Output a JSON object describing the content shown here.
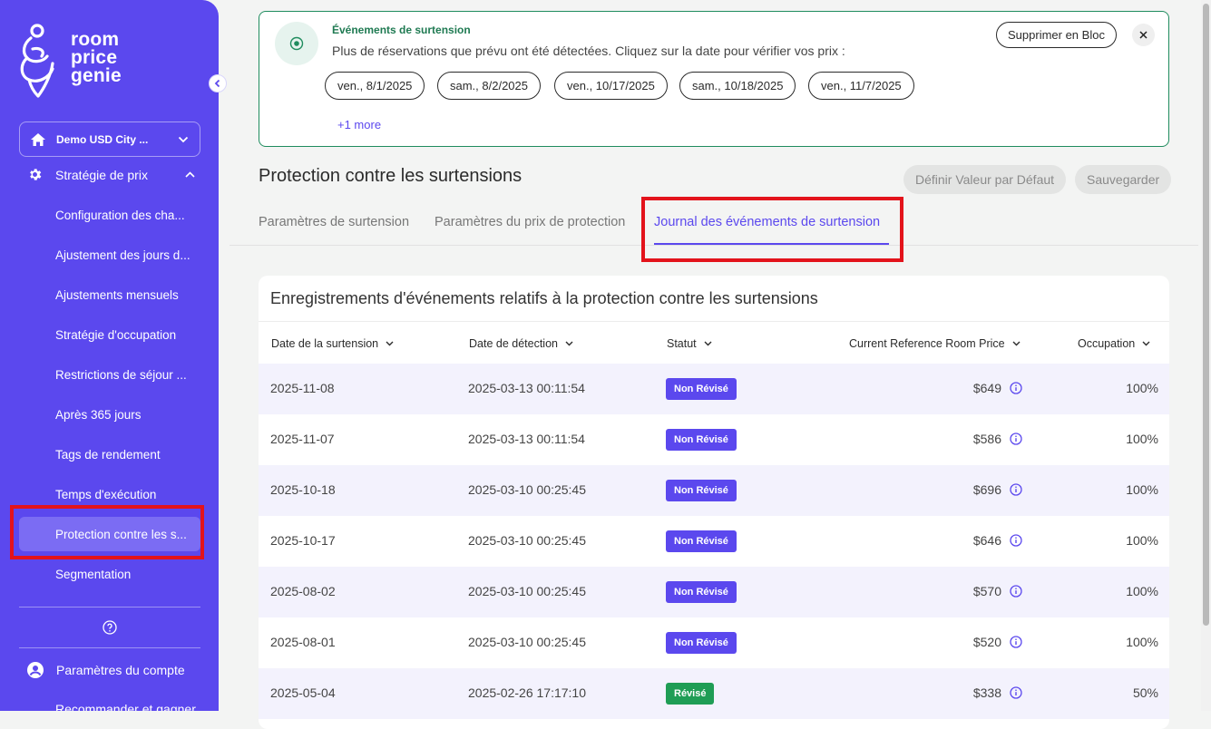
{
  "sidebar": {
    "logo_lines": [
      "room",
      "price",
      "genie"
    ],
    "hotel_name": "Demo USD City ...",
    "parent_label": "Stratégie de prix",
    "items": [
      {
        "label": "Configuration des cha..."
      },
      {
        "label": "Ajustement des jours d..."
      },
      {
        "label": "Ajustements mensuels"
      },
      {
        "label": "Stratégie d'occupation"
      },
      {
        "label": "Restrictions de séjour ..."
      },
      {
        "label": "Après 365 jours"
      },
      {
        "label": "Tags de rendement"
      },
      {
        "label": "Temps d'exécution"
      },
      {
        "label": "Protection contre les s..."
      },
      {
        "label": "Segmentation"
      }
    ],
    "account_label": "Paramètres du compte",
    "recommend_label": "Recommander et gagner"
  },
  "alert": {
    "title": "Événements de surtension",
    "message": "Plus de réservations que prévu ont été détectées. Cliquez sur la date pour vérifier vos prix :",
    "dates": [
      "ven., 8/1/2025",
      "sam., 8/2/2025",
      "ven., 10/17/2025",
      "sam., 10/18/2025",
      "ven., 11/7/2025"
    ],
    "more_label": "+1 more",
    "bulk_delete_label": "Supprimer en Bloc"
  },
  "page": {
    "title": "Protection contre les surtensions",
    "default_button": "Définir Valeur par Défaut",
    "save_button": "Sauvegarder"
  },
  "tabs": [
    "Paramètres de surtension",
    "Paramètres du prix de protection",
    "Journal des événements de surtension"
  ],
  "table": {
    "title": "Enregistrements d'événements relatifs à la protection contre les surtensions",
    "columns": [
      "Date de la surtension",
      "Date de détection",
      "Statut",
      "Current Reference Room Price",
      "Occupation"
    ],
    "rows": [
      {
        "date": "2025-11-08",
        "detected": "2025-03-13 00:11:54",
        "status": "Non Révisé",
        "price": "$649",
        "occupancy": "100%"
      },
      {
        "date": "2025-11-07",
        "detected": "2025-03-13 00:11:54",
        "status": "Non Révisé",
        "price": "$586",
        "occupancy": "100%"
      },
      {
        "date": "2025-10-18",
        "detected": "2025-03-10 00:25:45",
        "status": "Non Révisé",
        "price": "$696",
        "occupancy": "100%"
      },
      {
        "date": "2025-10-17",
        "detected": "2025-03-10 00:25:45",
        "status": "Non Révisé",
        "price": "$646",
        "occupancy": "100%"
      },
      {
        "date": "2025-08-02",
        "detected": "2025-03-10 00:25:45",
        "status": "Non Révisé",
        "price": "$570",
        "occupancy": "100%"
      },
      {
        "date": "2025-08-01",
        "detected": "2025-03-10 00:25:45",
        "status": "Non Révisé",
        "price": "$520",
        "occupancy": "100%"
      },
      {
        "date": "2025-05-04",
        "detected": "2025-02-26 17:17:10",
        "status": "Révisé",
        "price": "$338",
        "occupancy": "50%"
      }
    ]
  },
  "colors": {
    "brand": "#5b48ee",
    "not_reviewed": "#5b48ee",
    "reviewed": "#1f9d55",
    "alert_border": "#1f8c5e",
    "highlight": "#e3131b"
  }
}
